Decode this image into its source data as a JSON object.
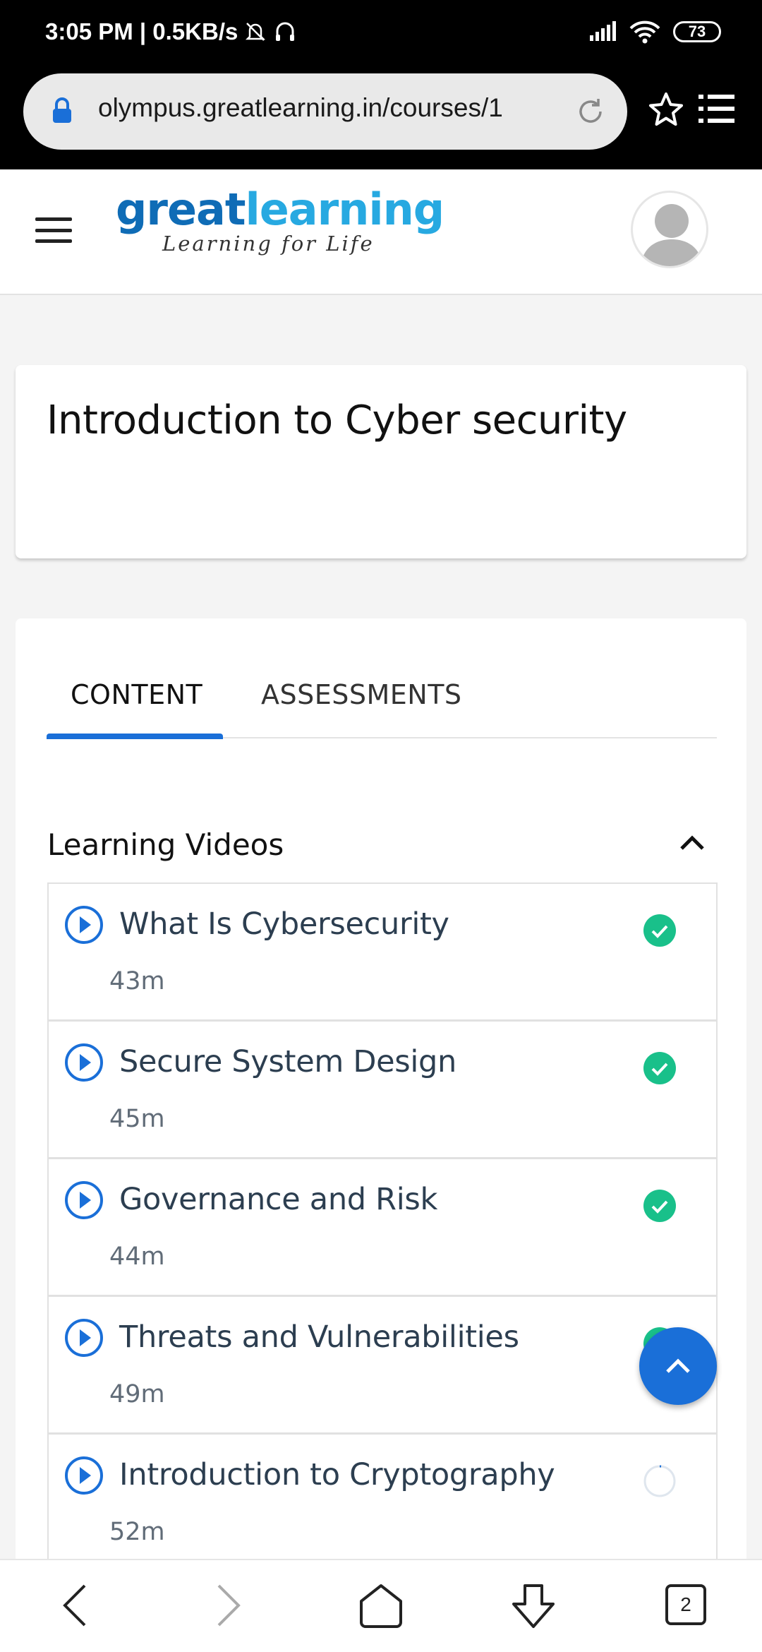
{
  "status_bar": {
    "time_speed": "3:05 PM | 0.5KB/s",
    "battery": "73"
  },
  "browser": {
    "url": "olympus.greatlearning.in/courses/1",
    "tab_count": "2"
  },
  "header": {
    "logo_part1": "great",
    "logo_part2": "learning",
    "tagline": "Learning for Life"
  },
  "course": {
    "title": "Introduction to Cyber security"
  },
  "tabs": [
    {
      "label": "CONTENT",
      "active": true
    },
    {
      "label": "ASSESSMENTS",
      "active": false
    }
  ],
  "section": {
    "title": "Learning Videos"
  },
  "videos": [
    {
      "title": "What Is Cybersecurity",
      "duration": "43m",
      "status": "completed"
    },
    {
      "title": "Secure System Design",
      "duration": "45m",
      "status": "completed"
    },
    {
      "title": "Governance and Risk",
      "duration": "44m",
      "status": "completed"
    },
    {
      "title": "Threats and Vulnerabilities",
      "duration": "49m",
      "status": "completed"
    },
    {
      "title": "Introduction to Cryptography",
      "duration": "52m",
      "status": "in-progress"
    }
  ],
  "colors": {
    "accent": "#1a6fd8",
    "success": "#19c08a",
    "logo_dark": "#0f6cb6",
    "logo_light": "#27a9e1"
  }
}
